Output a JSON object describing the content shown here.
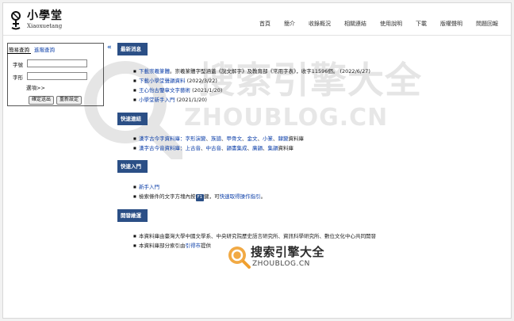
{
  "logo": {
    "name_cn": "小學堂",
    "name_en": "Xiaoxuetang"
  },
  "nav": [
    "首頁",
    "簡介",
    "收錄概況",
    "相關連結",
    "使用說明",
    "下載",
    "版權聲明",
    "問題回報"
  ],
  "search_panel": {
    "tab_simple": "簡易查詢",
    "tab_advanced": "進階查詢",
    "collapse": "«",
    "field_char_label": "字號",
    "field_char_value": "",
    "field_shape_label": "字形",
    "field_shape_value": "",
    "options": "選項>>",
    "submit": "確定送出",
    "reset": "重新設定"
  },
  "sections": {
    "news": {
      "title": "最新消息",
      "items": [
        {
          "link": "下載崇羲篆體",
          "text": "。崇羲篆體字型涵蓋《說文解字》及教育部《常用字表》，收字11596個。 (2022/6/27)"
        },
        {
          "link": "下載小學堂聲韻資料",
          "text": " (2022/3/22)"
        },
        {
          "link": "王心怡古鑒章文字藝術",
          "text": " (2021/1/20)"
        },
        {
          "link": "小學堂新手入門",
          "text": " (2021/1/20)"
        }
      ]
    },
    "quick_links": {
      "title": "快速連結",
      "row1_prefix": "漢字古今字資料庫：",
      "row1_links": [
        "字形演變",
        "、",
        "族譜",
        "、",
        "甲骨文",
        "、",
        "金文",
        "、",
        "小篆",
        "、",
        "隸變"
      ],
      "row1_suffix": "資料庫",
      "row2_prefix": "漢字古今音資料庫：",
      "row2_links": [
        "上古音",
        "、",
        "中古音",
        "、",
        "韻書集成",
        "、",
        "廣韻",
        "、",
        "集韻"
      ],
      "row2_suffix": "資料庫"
    },
    "getting_started": {
      "title": "快速入門",
      "item1": "新手入門",
      "item2_prefix": "檢索條件的文字方塊內按",
      "item2_key": "F1",
      "item2_mid": "鍵，可",
      "item2_link": "快速取得操作指引",
      "item2_suffix": "。"
    },
    "development": {
      "title": "開發維運",
      "item1": "本資料庫由臺灣大學中國文學系、中央研究院歷史語言研究所、資訊科學研究所、數位文化中心共同開發",
      "item2_prefix": "本資料庫部分索引由",
      "item2_link": "引得市",
      "item2_suffix": "提供"
    }
  },
  "watermark": {
    "big_cn": "搜索引擎大全",
    "big_en": "ZHOUBLOG.CN",
    "small_cn": "搜索引擎大全",
    "small_en": "ZHOUBLOG.CN"
  },
  "colors": {
    "section_head": "#2b4f86",
    "link": "#0b3ea8",
    "watermark_accent": "#f0a030"
  }
}
